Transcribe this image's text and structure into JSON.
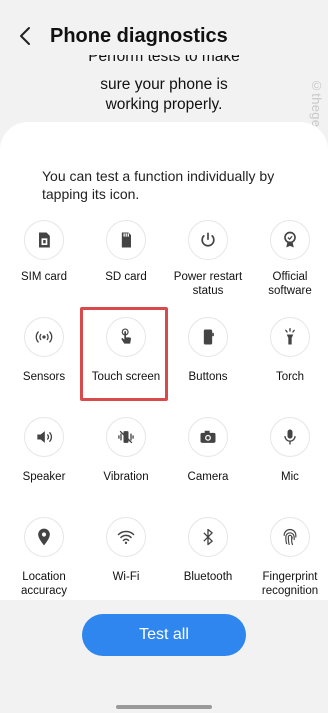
{
  "header": {
    "title": "Phone diagnostics"
  },
  "intro": {
    "line1": "Perform tests to make",
    "line2": "sure your phone is",
    "line3": "working properly."
  },
  "watermark": "©thegeekpage.com",
  "card": {
    "description": "You can test a function individually by tapping its icon."
  },
  "tests": [
    {
      "label": "SIM card",
      "icon": "sim-card-icon"
    },
    {
      "label": "SD card",
      "icon": "sd-card-icon"
    },
    {
      "label": "Power restart status",
      "icon": "power-restart-icon"
    },
    {
      "label": "Official software",
      "icon": "official-software-icon"
    },
    {
      "label": "Sensors",
      "icon": "sensors-icon"
    },
    {
      "label": "Touch screen",
      "icon": "touch-screen-icon"
    },
    {
      "label": "Buttons",
      "icon": "buttons-icon"
    },
    {
      "label": "Torch",
      "icon": "torch-icon"
    },
    {
      "label": "Speaker",
      "icon": "speaker-icon"
    },
    {
      "label": "Vibration",
      "icon": "vibration-icon"
    },
    {
      "label": "Camera",
      "icon": "camera-icon"
    },
    {
      "label": "Mic",
      "icon": "mic-icon"
    },
    {
      "label": "Location accuracy",
      "icon": "location-icon"
    },
    {
      "label": "Wi-Fi",
      "icon": "wifi-icon"
    },
    {
      "label": "Bluetooth",
      "icon": "bluetooth-icon"
    },
    {
      "label": "Fingerprint recognition",
      "icon": "fingerprint-icon"
    }
  ],
  "actions": {
    "test_all_label": "Test all"
  },
  "colors": {
    "accent": "#2f86ee",
    "highlight": "#d94b4b"
  }
}
